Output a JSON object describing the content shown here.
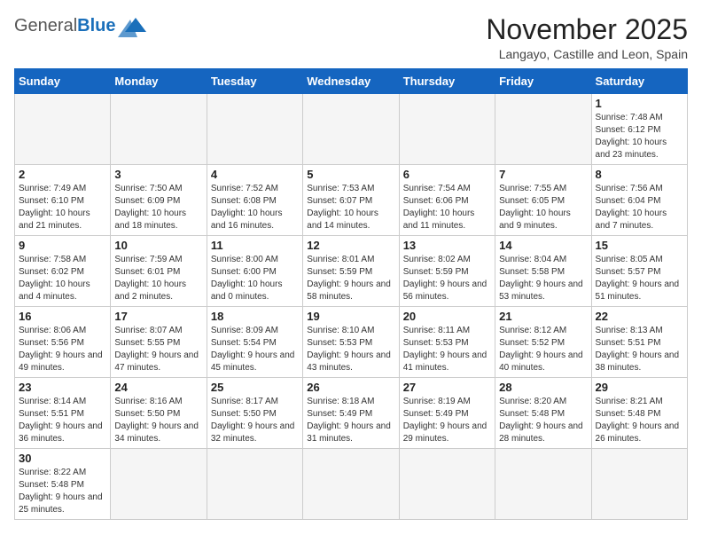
{
  "header": {
    "logo_general": "General",
    "logo_blue": "Blue",
    "month_title": "November 2025",
    "subtitle": "Langayo, Castille and Leon, Spain"
  },
  "weekdays": [
    "Sunday",
    "Monday",
    "Tuesday",
    "Wednesday",
    "Thursday",
    "Friday",
    "Saturday"
  ],
  "weeks": [
    [
      {
        "day": "",
        "info": ""
      },
      {
        "day": "",
        "info": ""
      },
      {
        "day": "",
        "info": ""
      },
      {
        "day": "",
        "info": ""
      },
      {
        "day": "",
        "info": ""
      },
      {
        "day": "",
        "info": ""
      },
      {
        "day": "1",
        "info": "Sunrise: 7:48 AM\nSunset: 6:12 PM\nDaylight: 10 hours and 23 minutes."
      }
    ],
    [
      {
        "day": "2",
        "info": "Sunrise: 7:49 AM\nSunset: 6:10 PM\nDaylight: 10 hours and 21 minutes."
      },
      {
        "day": "3",
        "info": "Sunrise: 7:50 AM\nSunset: 6:09 PM\nDaylight: 10 hours and 18 minutes."
      },
      {
        "day": "4",
        "info": "Sunrise: 7:52 AM\nSunset: 6:08 PM\nDaylight: 10 hours and 16 minutes."
      },
      {
        "day": "5",
        "info": "Sunrise: 7:53 AM\nSunset: 6:07 PM\nDaylight: 10 hours and 14 minutes."
      },
      {
        "day": "6",
        "info": "Sunrise: 7:54 AM\nSunset: 6:06 PM\nDaylight: 10 hours and 11 minutes."
      },
      {
        "day": "7",
        "info": "Sunrise: 7:55 AM\nSunset: 6:05 PM\nDaylight: 10 hours and 9 minutes."
      },
      {
        "day": "8",
        "info": "Sunrise: 7:56 AM\nSunset: 6:04 PM\nDaylight: 10 hours and 7 minutes."
      }
    ],
    [
      {
        "day": "9",
        "info": "Sunrise: 7:58 AM\nSunset: 6:02 PM\nDaylight: 10 hours and 4 minutes."
      },
      {
        "day": "10",
        "info": "Sunrise: 7:59 AM\nSunset: 6:01 PM\nDaylight: 10 hours and 2 minutes."
      },
      {
        "day": "11",
        "info": "Sunrise: 8:00 AM\nSunset: 6:00 PM\nDaylight: 10 hours and 0 minutes."
      },
      {
        "day": "12",
        "info": "Sunrise: 8:01 AM\nSunset: 5:59 PM\nDaylight: 9 hours and 58 minutes."
      },
      {
        "day": "13",
        "info": "Sunrise: 8:02 AM\nSunset: 5:59 PM\nDaylight: 9 hours and 56 minutes."
      },
      {
        "day": "14",
        "info": "Sunrise: 8:04 AM\nSunset: 5:58 PM\nDaylight: 9 hours and 53 minutes."
      },
      {
        "day": "15",
        "info": "Sunrise: 8:05 AM\nSunset: 5:57 PM\nDaylight: 9 hours and 51 minutes."
      }
    ],
    [
      {
        "day": "16",
        "info": "Sunrise: 8:06 AM\nSunset: 5:56 PM\nDaylight: 9 hours and 49 minutes."
      },
      {
        "day": "17",
        "info": "Sunrise: 8:07 AM\nSunset: 5:55 PM\nDaylight: 9 hours and 47 minutes."
      },
      {
        "day": "18",
        "info": "Sunrise: 8:09 AM\nSunset: 5:54 PM\nDaylight: 9 hours and 45 minutes."
      },
      {
        "day": "19",
        "info": "Sunrise: 8:10 AM\nSunset: 5:53 PM\nDaylight: 9 hours and 43 minutes."
      },
      {
        "day": "20",
        "info": "Sunrise: 8:11 AM\nSunset: 5:53 PM\nDaylight: 9 hours and 41 minutes."
      },
      {
        "day": "21",
        "info": "Sunrise: 8:12 AM\nSunset: 5:52 PM\nDaylight: 9 hours and 40 minutes."
      },
      {
        "day": "22",
        "info": "Sunrise: 8:13 AM\nSunset: 5:51 PM\nDaylight: 9 hours and 38 minutes."
      }
    ],
    [
      {
        "day": "23",
        "info": "Sunrise: 8:14 AM\nSunset: 5:51 PM\nDaylight: 9 hours and 36 minutes."
      },
      {
        "day": "24",
        "info": "Sunrise: 8:16 AM\nSunset: 5:50 PM\nDaylight: 9 hours and 34 minutes."
      },
      {
        "day": "25",
        "info": "Sunrise: 8:17 AM\nSunset: 5:50 PM\nDaylight: 9 hours and 32 minutes."
      },
      {
        "day": "26",
        "info": "Sunrise: 8:18 AM\nSunset: 5:49 PM\nDaylight: 9 hours and 31 minutes."
      },
      {
        "day": "27",
        "info": "Sunrise: 8:19 AM\nSunset: 5:49 PM\nDaylight: 9 hours and 29 minutes."
      },
      {
        "day": "28",
        "info": "Sunrise: 8:20 AM\nSunset: 5:48 PM\nDaylight: 9 hours and 28 minutes."
      },
      {
        "day": "29",
        "info": "Sunrise: 8:21 AM\nSunset: 5:48 PM\nDaylight: 9 hours and 26 minutes."
      }
    ],
    [
      {
        "day": "30",
        "info": "Sunrise: 8:22 AM\nSunset: 5:48 PM\nDaylight: 9 hours and 25 minutes."
      },
      {
        "day": "",
        "info": ""
      },
      {
        "day": "",
        "info": ""
      },
      {
        "day": "",
        "info": ""
      },
      {
        "day": "",
        "info": ""
      },
      {
        "day": "",
        "info": ""
      },
      {
        "day": "",
        "info": ""
      }
    ]
  ]
}
